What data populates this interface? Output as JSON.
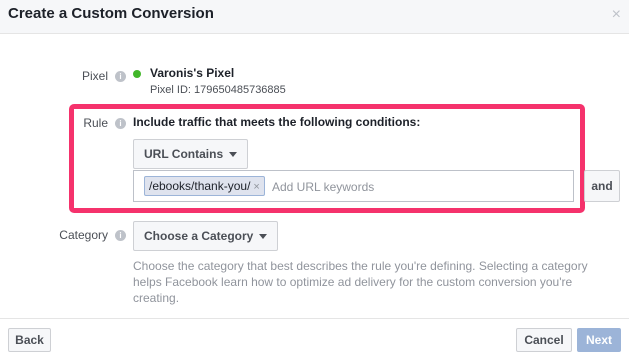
{
  "dialog": {
    "title": "Create a Custom Conversion",
    "close_symbol": "×"
  },
  "info_glyph": "i",
  "pixel": {
    "label": "Pixel",
    "name": "Varonis's Pixel",
    "id_text": "Pixel ID: 179650485736885",
    "status_color": "#42b72a"
  },
  "rule": {
    "label": "Rule",
    "condition_text": "Include traffic that meets the following conditions:",
    "operator": "URL Contains",
    "keywords": [
      {
        "text": "/ebooks/thank-you/",
        "remove": "×"
      }
    ],
    "input_placeholder": "Add URL keywords",
    "and_label": "and",
    "highlight_color": "#f5326c"
  },
  "category": {
    "label": "Category",
    "dropdown_label": "Choose a Category",
    "help_text": "Choose the category that best describes the rule you're defining. Selecting a category helps Facebook learn how to optimize ad delivery for the custom conversion you're creating."
  },
  "footer": {
    "back_label": "Back",
    "cancel_label": "Cancel",
    "next_label": "Next"
  }
}
